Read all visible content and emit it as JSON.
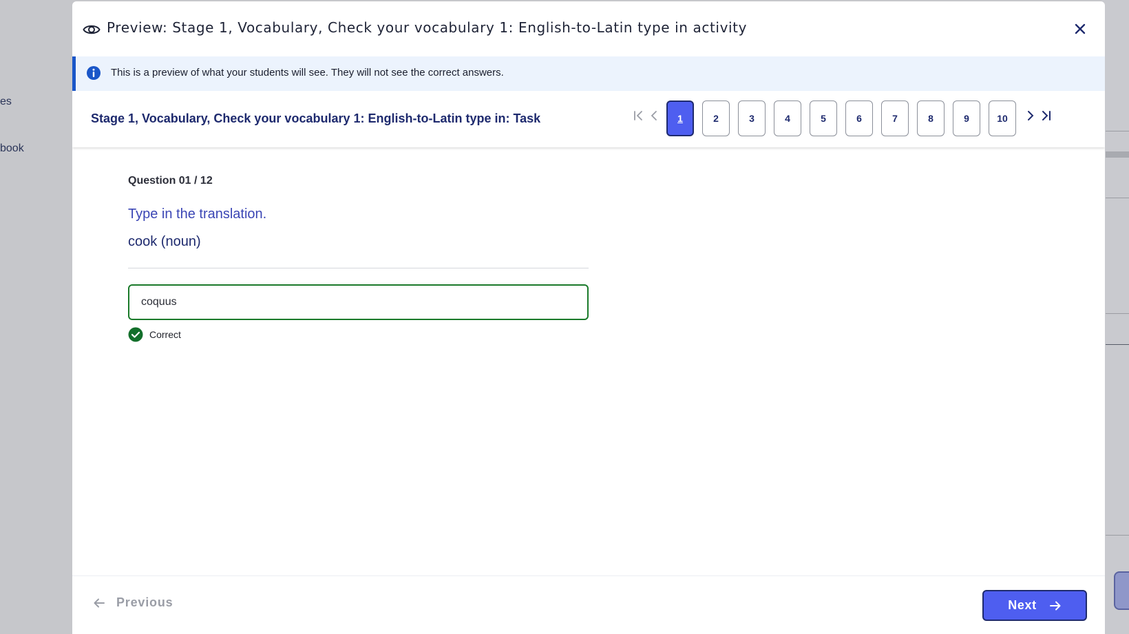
{
  "background": {
    "left_items": [
      "es",
      "book"
    ]
  },
  "modal": {
    "title": "Preview: Stage 1, Vocabulary, Check your vocabulary 1: English-to-Latin type in activity",
    "close_icon": "close-icon",
    "info_banner": {
      "text": "This is a preview of what your students will see. They will not see the correct answers.",
      "icon": "info-icon"
    },
    "task": {
      "title": "Stage 1, Vocabulary, Check your vocabulary 1: English-to-Latin type in: Task",
      "pages": [
        "1",
        "2",
        "3",
        "4",
        "5",
        "6",
        "7",
        "8",
        "9",
        "10"
      ],
      "active_page": "1"
    },
    "question": {
      "counter": "Question 01 / 12",
      "prompt": "Type in the translation.",
      "word": "cook (noun)",
      "answer_value": "coquus",
      "feedback": "Correct"
    },
    "footer": {
      "previous_label": "Previous",
      "next_label": "Next"
    }
  },
  "colors": {
    "accent": "#4e5ef0",
    "navy": "#1e2a6e",
    "correct": "#1a7a2a",
    "info_bg": "#ecf3fd"
  }
}
